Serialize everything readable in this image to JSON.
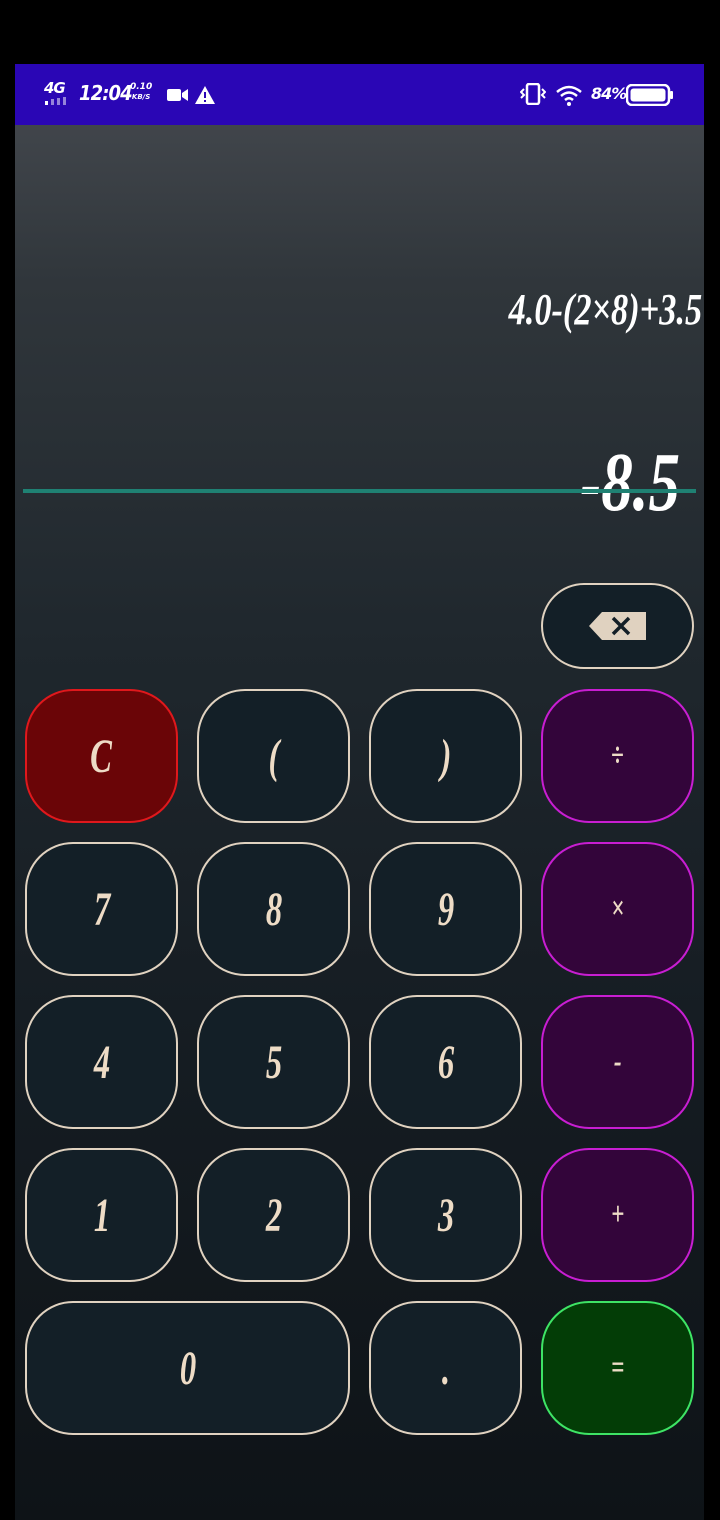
{
  "status_bar": {
    "network": "4G",
    "time": "12:04",
    "speed_value": "0.10",
    "speed_unit": "KB/S",
    "battery_percent": "84%",
    "icons": [
      "signal-icon",
      "video-camera-icon",
      "warning-icon",
      "vibrate-icon",
      "wifi-icon",
      "battery-icon"
    ]
  },
  "display": {
    "expression": "4.0-(2×8)+3.5",
    "result": "-8.5"
  },
  "keys": {
    "clear": "C",
    "open_paren": "(",
    "close_paren": ")",
    "divide": "÷",
    "seven": "7",
    "eight": "8",
    "nine": "9",
    "multiply": "×",
    "four": "4",
    "five": "5",
    "six": "6",
    "subtract": "-",
    "one": "1",
    "two": "2",
    "three": "3",
    "add": "+",
    "zero": "0",
    "decimal": ".",
    "equals": "="
  },
  "colors": {
    "status_bar": "#2a06b5",
    "divider": "#1f8173",
    "number_key_border": "#e0d2c0",
    "operator_key": "#33053a",
    "operator_border": "#c81ed2",
    "clear_key": "#6a0507",
    "clear_border": "#e0181c",
    "equals_key": "#033d06",
    "equals_border": "#3ee465"
  }
}
